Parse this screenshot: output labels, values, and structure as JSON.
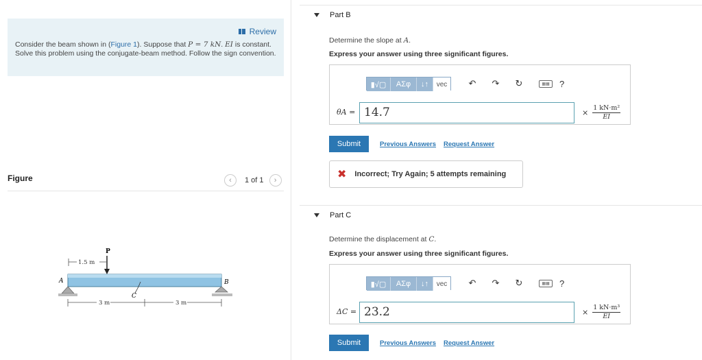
{
  "problem": {
    "review_label": "Review",
    "text_1": "Consider the beam shown in (",
    "figure_link": "Figure 1",
    "text_2": "). Suppose that ",
    "p_eq": "P = 7 kN",
    "text_3": ". ",
    "ei": "EI",
    "text_4": " is constant. Solve this problem using the conjugate-beam method. Follow the sign convention."
  },
  "figure": {
    "label": "Figure",
    "counter": "1 of 1",
    "prev_icon": "chevron-left-icon",
    "next_icon": "chevron-right-icon",
    "beam": {
      "load_label": "P",
      "dim_top": "1.5 m",
      "label_a": "A",
      "label_b": "B",
      "label_c": "C",
      "dim_left": "3 m",
      "dim_right": "3 m"
    }
  },
  "toolbar": {
    "templates": "▮√▢",
    "greek": "ΑΣφ",
    "sort": "↓↑",
    "vec": "vec",
    "undo_icon": "undo-icon",
    "redo_icon": "redo-icon",
    "reset_icon": "reset-icon",
    "keyboard_icon": "keyboard-icon",
    "help": "?"
  },
  "part_b": {
    "title": "Part B",
    "question_pre": "Determine the slope at ",
    "question_var": "A",
    "question_post": ".",
    "instruction": "Express your answer using three significant figures.",
    "answer_label": "θA =",
    "answer_value": "14.7",
    "unit_num": "1 kN·m²",
    "unit_den": "EI",
    "submit": "Submit",
    "previous_answers": "Previous Answers",
    "request_answer": "Request Answer",
    "feedback": "Incorrect; Try Again; 5 attempts remaining"
  },
  "part_c": {
    "title": "Part C",
    "question_pre": "Determine the displacement at ",
    "question_var": "C",
    "question_post": ".",
    "instruction": "Express your answer using three significant figures.",
    "answer_label": "ΔC =",
    "answer_value": "23.2",
    "unit_num": "1 kN·m³",
    "unit_den": "EI",
    "submit": "Submit",
    "previous_answers": "Previous Answers",
    "request_answer": "Request Answer"
  },
  "colors": {
    "accent": "#2b77b3",
    "problem_bg": "#e8f2f6",
    "error": "#c9302c",
    "toolbar": "#9bb8d3"
  }
}
